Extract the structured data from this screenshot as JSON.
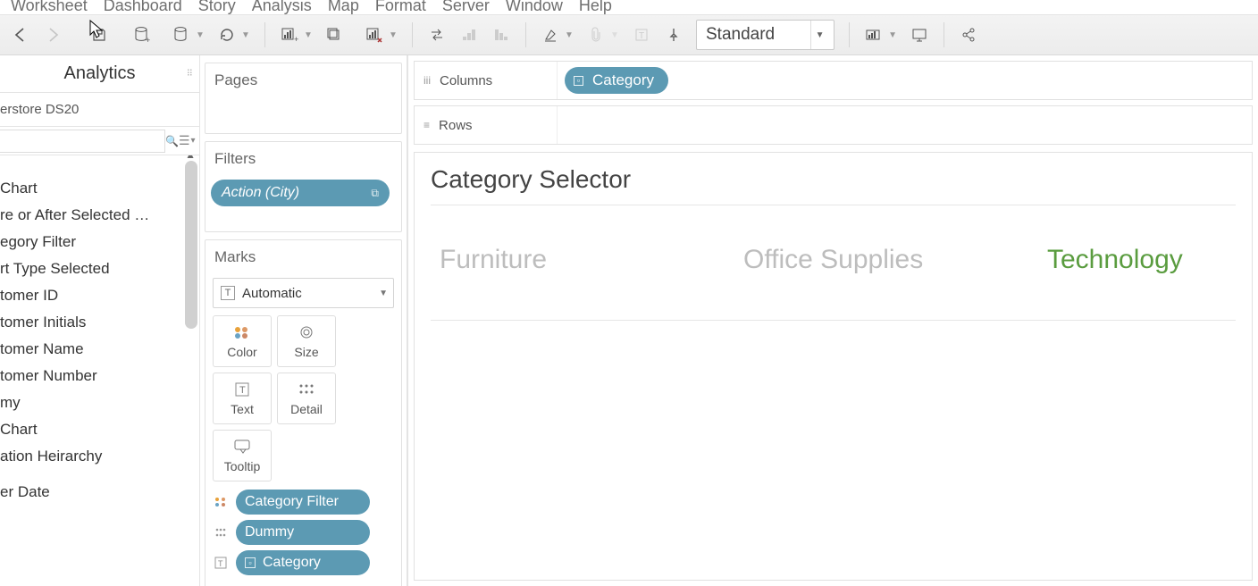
{
  "menubar": {
    "items": [
      "Worksheet",
      "Dashboard",
      "Story",
      "Analysis",
      "Map",
      "Format",
      "Server",
      "Window",
      "Help"
    ]
  },
  "toolbar": {
    "fit_label": "Standard"
  },
  "sidebar": {
    "tab_label": "Analytics",
    "datasource": "erstore DS20",
    "fields": [
      "Chart",
      "re or After Selected …",
      "egory Filter",
      "rt Type Selected",
      "tomer ID",
      "tomer Initials",
      "tomer Name",
      "tomer Number",
      "my",
      " Chart",
      "ation Heirarchy",
      "",
      "er Date"
    ]
  },
  "pages": {
    "title": "Pages"
  },
  "filters": {
    "title": "Filters",
    "pill": "Action (City)"
  },
  "marks": {
    "title": "Marks",
    "auto_label": "Automatic",
    "cells": {
      "color": "Color",
      "size": "Size",
      "text": "Text",
      "detail": "Detail",
      "tooltip": "Tooltip"
    },
    "pills": [
      {
        "label": "Category Filter"
      },
      {
        "label": "Dummy"
      },
      {
        "label": "Category",
        "box": true
      }
    ]
  },
  "shelves": {
    "columns_label": "Columns",
    "rows_label": "Rows",
    "columns_pill": "Category"
  },
  "viz": {
    "title": "Category Selector",
    "headers": [
      {
        "label": "Furniture",
        "highlight": false
      },
      {
        "label": "Office Supplies",
        "highlight": false
      },
      {
        "label": "Technology",
        "highlight": true
      }
    ]
  }
}
